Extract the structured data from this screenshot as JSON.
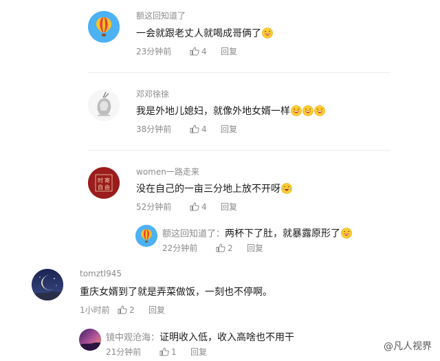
{
  "comments": [
    {
      "name": "额这回知道了",
      "text": "一会就跟老丈人就喝成哥俩了",
      "emojis": 1,
      "time": "23分钟前",
      "likes": "4",
      "reply": "回复",
      "avatar": "hot-air-balloon"
    },
    {
      "name": "邓邓徐徐",
      "text": "我是外地儿媳妇，就像外地女婿一样",
      "emojis": 3,
      "time": "38分钟前",
      "likes": "4",
      "reply": "回复",
      "avatar": "sketch-girl"
    },
    {
      "name": "women一路走来",
      "text": "没在自己的一亩三分地上放不开呀",
      "emojis": 1,
      "time": "52分钟前",
      "likes": "4",
      "reply": "回复",
      "avatar": "red-seal",
      "avatar_text": [
        "时",
        "寄",
        "自",
        "由"
      ]
    },
    {
      "name": "额这回知道了：",
      "text": "两杯下了肚，就暴露原形了",
      "emojis": 1,
      "time": "22分钟前",
      "likes": "2",
      "reply": "回复",
      "avatar": "hot-air-balloon"
    },
    {
      "name": "tomztl945",
      "text": "重庆女婿到了就是弄菜做饭，一刻也不停啊。",
      "emojis": 0,
      "time": "1小时前",
      "likes": "2",
      "reply": "回复",
      "avatar": "moon-night"
    },
    {
      "name": "镜中观沧海：",
      "text": "证明收入低，收入高啥也不用干",
      "emojis": 0,
      "time": "21分钟前",
      "likes": "1",
      "reply": "回复",
      "avatar": "purple-sky"
    }
  ],
  "watermark": "@凡人视界",
  "colors": {
    "meta": "#8a8a8a",
    "text": "#1a1a1a",
    "divider": "#ececec"
  }
}
